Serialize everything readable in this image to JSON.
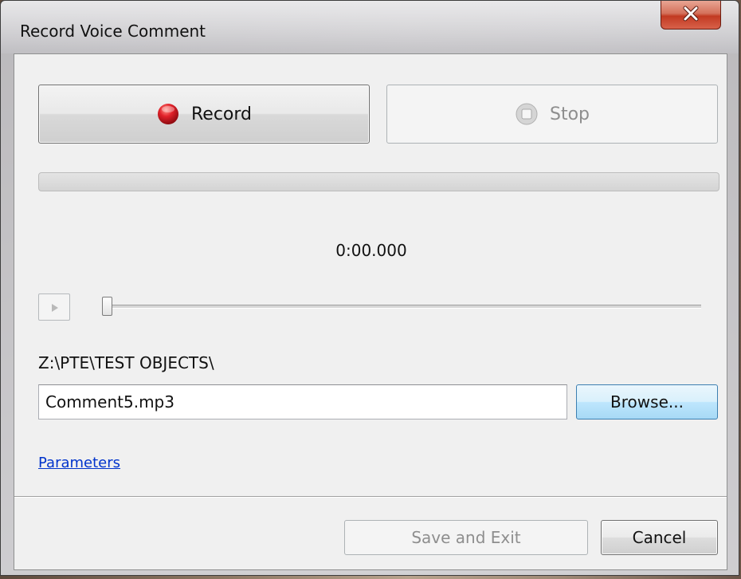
{
  "window": {
    "title": "Record Voice Comment",
    "close_icon": "close-icon"
  },
  "controls": {
    "record_label": "Record",
    "record_icon": "record-icon",
    "stop_label": "Stop",
    "stop_icon": "stop-icon",
    "stop_enabled": false
  },
  "progress": {
    "fraction": 0
  },
  "playback": {
    "time": "0:00.000",
    "play_icon": "play-icon",
    "position_fraction": 0
  },
  "file": {
    "folder": "Z:\\PTE\\TEST OBJECTS\\",
    "name": "Comment5.mp3",
    "browse_label": "Browse..."
  },
  "parameters_link": "Parameters",
  "footer": {
    "save_label": "Save and Exit",
    "save_enabled": false,
    "cancel_label": "Cancel"
  },
  "colors": {
    "record_red": "#d0161c",
    "link_blue": "#0033cc",
    "close_red": "#c23a22",
    "browse_blue": "#bee6fd"
  }
}
